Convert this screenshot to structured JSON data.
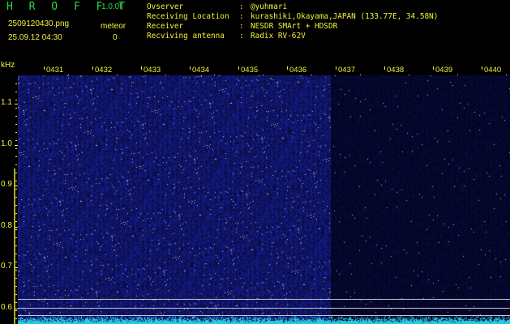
{
  "header": {
    "app_title": "H R O F F T",
    "app_version": "1.0.0f",
    "filename": "2509120430.png",
    "timestamp": "25.09.12 04:30",
    "meteor_label": "meteor",
    "meteor_count": "0",
    "info_rows": [
      {
        "key": "Ovserver",
        "sep": ":",
        "value": "@yuhmari"
      },
      {
        "key": "Receiving Location",
        "sep": ":",
        "value": "kurashiki,Okayama,JAPAN (133.77E, 34.58N)"
      },
      {
        "key": "Receiver",
        "sep": ":",
        "value": "NESDR SMArt + HDSDR"
      },
      {
        "key": "Recviving antenna",
        "sep": ":",
        "value": "Radix RV-62V"
      }
    ]
  },
  "axes": {
    "y_unit": "kHz",
    "y_ticks": [
      "1.1",
      "1.0",
      "0.9",
      "0.8",
      "0.7",
      "0.6"
    ],
    "x_ticks": [
      "0431",
      "0432",
      "0433",
      "0434",
      "0435",
      "0436",
      "0437",
      "0438",
      "0439",
      "0440"
    ]
  },
  "spectrogram": {
    "dense_until_minute": "0436",
    "colors": {
      "background": "#00001a",
      "dense_noise": "#1e28a0",
      "sparse_noise": "#10164a",
      "speckle": "#b4b4ff",
      "baseline": "#2ac8e0",
      "text": "#f2f23c",
      "title": "#2fd84a"
    }
  }
}
